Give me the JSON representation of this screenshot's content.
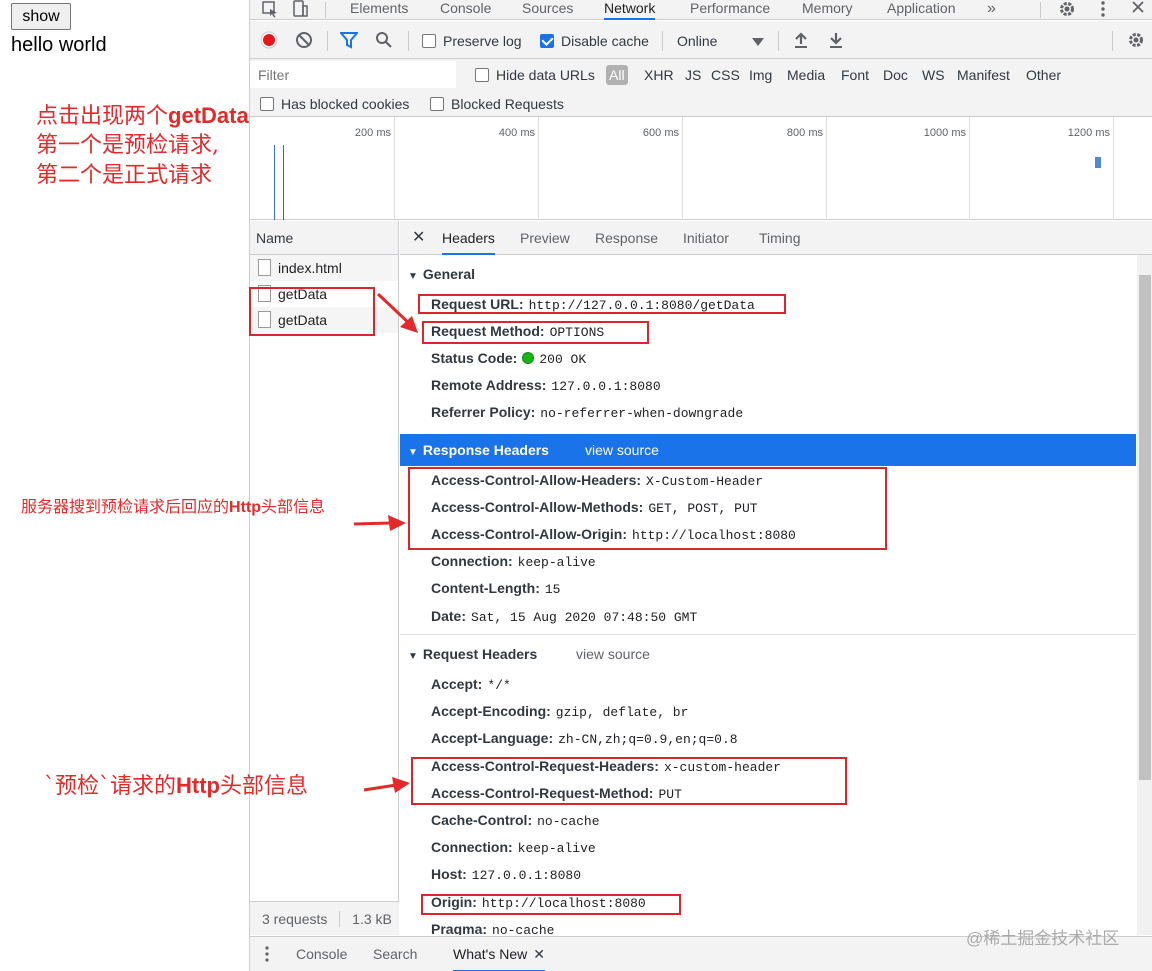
{
  "page": {
    "button_label": "show",
    "text": "hello world"
  },
  "devtools": {
    "tabs": [
      "Elements",
      "Console",
      "Sources",
      "Network",
      "Performance",
      "Memory",
      "Application"
    ],
    "active_tab": "Network",
    "more_icon": "»",
    "toolbar": {
      "preserve_log": "Preserve log",
      "disable_cache": "Disable cache",
      "throttle": "Online"
    },
    "filter": {
      "placeholder": "Filter",
      "hide_data_urls": "Hide data URLs",
      "types": [
        "All",
        "XHR",
        "JS",
        "CSS",
        "Img",
        "Media",
        "Font",
        "Doc",
        "WS",
        "Manifest",
        "Other"
      ],
      "has_blocked_cookies": "Has blocked cookies",
      "blocked_requests": "Blocked Requests"
    },
    "timeline_ticks": [
      "200 ms",
      "400 ms",
      "600 ms",
      "800 ms",
      "1000 ms",
      "1200 ms"
    ],
    "name_header": "Name",
    "requests": [
      "index.html",
      "getData",
      "getData"
    ],
    "footer": {
      "requests": "3 requests",
      "size": "1.3 kB"
    },
    "detail_tabs": [
      "Headers",
      "Preview",
      "Response",
      "Initiator",
      "Timing"
    ],
    "general": {
      "title": "General",
      "rows": [
        {
          "k": "Request URL:",
          "v": "http://127.0.0.1:8080/getData"
        },
        {
          "k": "Request Method:",
          "v": "OPTIONS"
        },
        {
          "k": "Status Code:",
          "v": "200 OK"
        },
        {
          "k": "Remote Address:",
          "v": "127.0.0.1:8080"
        },
        {
          "k": "Referrer Policy:",
          "v": "no-referrer-when-downgrade"
        }
      ]
    },
    "response_headers": {
      "title": "Response Headers",
      "view_source": "view source",
      "rows": [
        {
          "k": "Access-Control-Allow-Headers:",
          "v": "X-Custom-Header"
        },
        {
          "k": "Access-Control-Allow-Methods:",
          "v": "GET, POST, PUT"
        },
        {
          "k": "Access-Control-Allow-Origin:",
          "v": "http://localhost:8080"
        },
        {
          "k": "Connection:",
          "v": "keep-alive"
        },
        {
          "k": "Content-Length:",
          "v": "15"
        },
        {
          "k": "Date:",
          "v": "Sat, 15 Aug 2020 07:48:50 GMT"
        }
      ]
    },
    "request_headers": {
      "title": "Request Headers",
      "view_source": "view source",
      "rows": [
        {
          "k": "Accept:",
          "v": "*/*"
        },
        {
          "k": "Accept-Encoding:",
          "v": "gzip, deflate, br"
        },
        {
          "k": "Accept-Language:",
          "v": "zh-CN,zh;q=0.9,en;q=0.8"
        },
        {
          "k": "Access-Control-Request-Headers:",
          "v": "x-custom-header"
        },
        {
          "k": "Access-Control-Request-Method:",
          "v": "PUT"
        },
        {
          "k": "Cache-Control:",
          "v": "no-cache"
        },
        {
          "k": "Connection:",
          "v": "keep-alive"
        },
        {
          "k": "Host:",
          "v": "127.0.0.1:8080"
        },
        {
          "k": "Origin:",
          "v": "http://localhost:8080"
        },
        {
          "k": "Pragma:",
          "v": "no-cache"
        }
      ]
    },
    "drawer": [
      "Console",
      "Search",
      "What's New"
    ]
  },
  "annotations": {
    "line1_cn": "点击出现两个",
    "line1_latin": "getData",
    "line2": "第一个是预检请求,",
    "line3": "第二个是正式请求",
    "response_note_cn1": "服务器搜到预检请求后回应的",
    "response_note_latin": "Http",
    "response_note_cn2": "头部信息",
    "request_note_cn1": "`预检`请求的",
    "request_note_latin": "Http",
    "request_note_cn2": "头部信息"
  },
  "watermark": "@稀土掘金技术社区",
  "colors": {
    "accent": "#1a73e8",
    "annotation_red": "#d9262c",
    "record": "#e6161a"
  }
}
